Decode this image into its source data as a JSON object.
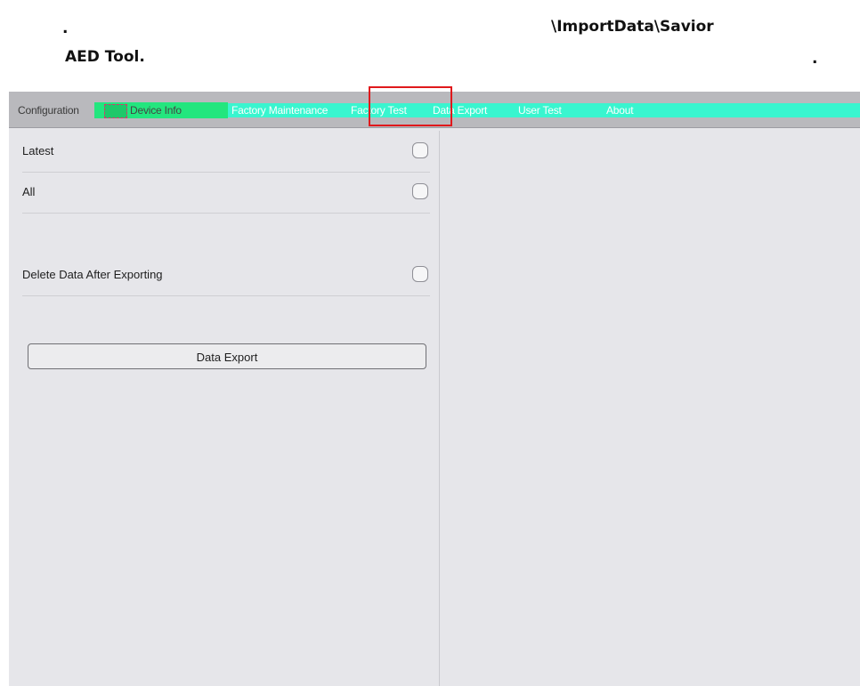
{
  "document": {
    "dot_left": ".",
    "path_text": "\\ImportData\\Savior",
    "aed_text": "AED Tool.",
    "dot_right": "."
  },
  "menu": {
    "tabs": [
      {
        "label": "Configuration"
      },
      {
        "label": "Device Info"
      },
      {
        "label": "Factory Maintenance"
      },
      {
        "label": "Factory Test"
      },
      {
        "label": "Data Export"
      },
      {
        "label": "User Test"
      },
      {
        "label": "About"
      }
    ],
    "highlight_color": "#e0191c",
    "strip_color": "#39f5cf"
  },
  "options": {
    "latest_label": "Latest",
    "all_label": "All",
    "delete_label": "Delete Data After Exporting"
  },
  "actions": {
    "export_label": "Data Export"
  }
}
